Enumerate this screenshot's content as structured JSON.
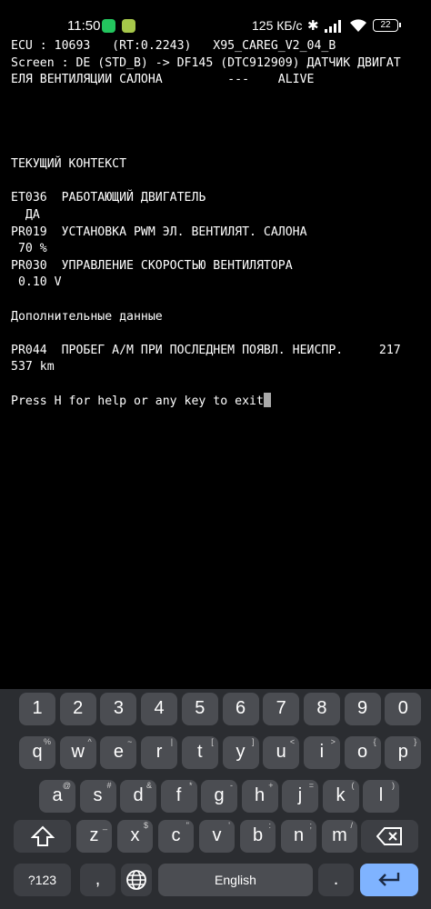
{
  "status_bar": {
    "time": "11:50",
    "net_speed": "125 КБ/с",
    "battery": "22"
  },
  "terminal": {
    "lines": [
      "ECU : 10693   (RT:0.2243)   X95_CAREG_V2_04_B",
      "Screen : DE (STD_B) -> DF145 (DTC912909) ДАТЧИК ДВИГАТ",
      "ЕЛЯ ВЕНТИЛЯЦИИ САЛОНА         ---    ALIVE",
      "",
      "",
      "",
      "",
      "ТЕКУЩИЙ КОНТЕКСТ",
      "",
      "ET036  РАБОТАЮЩИЙ ДВИГАТЕЛЬ",
      "  ДА",
      "PR019  УСТАНОВКА PWM ЭЛ. ВЕНТИЛЯТ. САЛОНА",
      " 70 %",
      "PR030  УПРАВЛЕНИЕ СКОРОСТЬЮ ВЕНТИЛЯТОРА",
      " 0.10 V",
      "",
      "Дополнительные данные",
      "",
      "PR044  ПРОБЕГ А/М ПРИ ПОСЛЕДНЕМ ПОЯВЛ. НЕИСПР.     217",
      "537 km",
      "",
      "Press H for help or any key to exit"
    ]
  },
  "keyboard": {
    "row1": [
      {
        "k": "1"
      },
      {
        "k": "2"
      },
      {
        "k": "3"
      },
      {
        "k": "4"
      },
      {
        "k": "5"
      },
      {
        "k": "6"
      },
      {
        "k": "7"
      },
      {
        "k": "8"
      },
      {
        "k": "9"
      },
      {
        "k": "0"
      }
    ],
    "row2": [
      {
        "k": "q",
        "h": "%"
      },
      {
        "k": "w",
        "h": "^"
      },
      {
        "k": "e",
        "h": "~"
      },
      {
        "k": "r",
        "h": "|"
      },
      {
        "k": "t",
        "h": "["
      },
      {
        "k": "y",
        "h": "]"
      },
      {
        "k": "u",
        "h": "<"
      },
      {
        "k": "i",
        "h": ">"
      },
      {
        "k": "o",
        "h": "{"
      },
      {
        "k": "p",
        "h": "}"
      }
    ],
    "row3": [
      {
        "k": "a",
        "h": "@"
      },
      {
        "k": "s",
        "h": "#"
      },
      {
        "k": "d",
        "h": "&"
      },
      {
        "k": "f",
        "h": "*"
      },
      {
        "k": "g",
        "h": "-"
      },
      {
        "k": "h",
        "h": "+"
      },
      {
        "k": "j",
        "h": "="
      },
      {
        "k": "k",
        "h": "("
      },
      {
        "k": "l",
        "h": ")"
      }
    ],
    "row4": [
      {
        "k": "z",
        "h": "_"
      },
      {
        "k": "x",
        "h": "$"
      },
      {
        "k": "c",
        "h": "\""
      },
      {
        "k": "v",
        "h": "'"
      },
      {
        "k": "b",
        "h": ":"
      },
      {
        "k": "n",
        "h": ";"
      },
      {
        "k": "m",
        "h": "/"
      }
    ],
    "symbols_label": "?123",
    "comma": ",",
    "space_label": "English",
    "period": "."
  }
}
